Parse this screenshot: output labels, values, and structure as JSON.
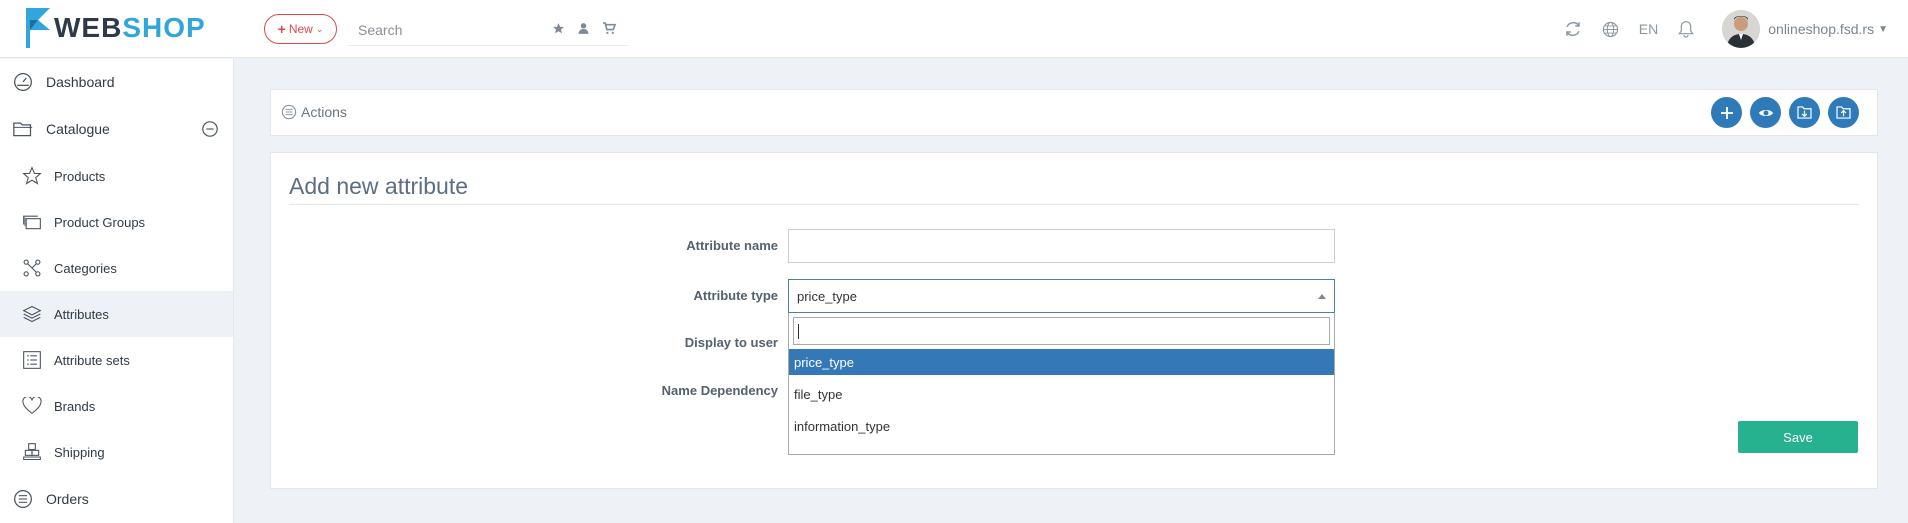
{
  "brand": {
    "part1": "WEB",
    "part2": "SHOP",
    "accent": "#31a5dc"
  },
  "topbar": {
    "new_label": "New",
    "search_placeholder": "Search",
    "language": "EN",
    "user_name": "onlineshop.fsd.rs",
    "new_color": "#e04848"
  },
  "sidebar": {
    "items": [
      {
        "label": "Dashboard",
        "icon": "dashboard-icon"
      },
      {
        "label": "Catalogue",
        "icon": "folder-icon"
      },
      {
        "label": "Products",
        "icon": "star-icon"
      },
      {
        "label": "Product Groups",
        "icon": "product-groups-icon"
      },
      {
        "label": "Categories",
        "icon": "categories-icon"
      },
      {
        "label": "Attributes",
        "icon": "layers-icon"
      },
      {
        "label": "Attribute sets",
        "icon": "list-icon"
      },
      {
        "label": "Brands",
        "icon": "heart-icon"
      },
      {
        "label": "Shipping",
        "icon": "shipping-icon"
      },
      {
        "label": "Orders",
        "icon": "orders-icon"
      }
    ],
    "active": "Attributes"
  },
  "actions": {
    "label": "Actions"
  },
  "form": {
    "title": "Add new attribute",
    "fields": {
      "attribute_name": {
        "label": "Attribute name",
        "value": ""
      },
      "attribute_type": {
        "label": "Attribute type",
        "value": "price_type"
      },
      "display_to_user": {
        "label": "Display to user"
      },
      "name_dependency": {
        "label": "Name Dependency"
      }
    },
    "dropdown": {
      "search_value": "",
      "options": [
        "price_type",
        "file_type",
        "information_type"
      ],
      "highlighted": "price_type"
    },
    "save_label": "Save",
    "save_color": "#26b18f"
  }
}
